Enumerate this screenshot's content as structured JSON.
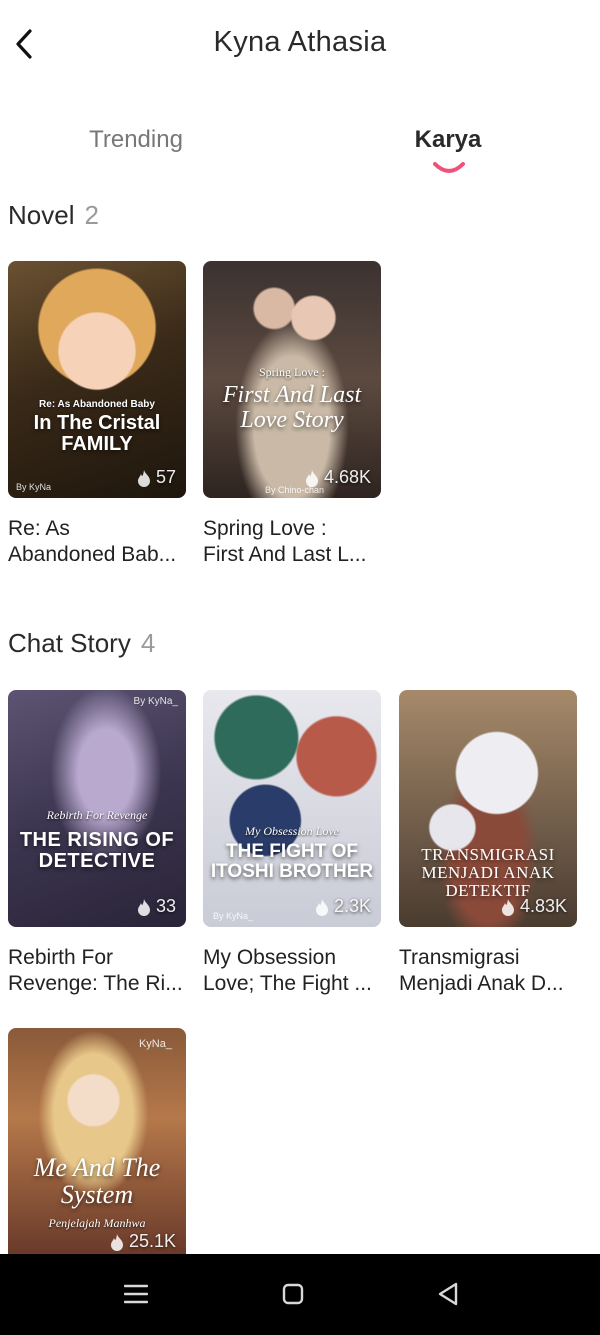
{
  "header": {
    "title": "Kyna Athasia",
    "back_icon": "chevron-left-icon"
  },
  "tabs": [
    {
      "label": "Trending",
      "active": false
    },
    {
      "label": "Karya",
      "active": true
    }
  ],
  "accent_color": "#f0507a",
  "sections": {
    "novel": {
      "title": "Novel",
      "count": "2",
      "items": [
        {
          "cover_sub": "Re: As Abandoned Baby",
          "cover_title": "In The Cristal FAMILY",
          "cover_author": "By KyNa",
          "stat": "57",
          "title_line1": "Re: As",
          "title_line2": "Abandoned Bab..."
        },
        {
          "cover_sub": "Spring Love :",
          "cover_title": "First And Last Love Story",
          "cover_author": "By Chino-chan",
          "stat": "4.68K",
          "title_line1": "Spring Love :",
          "title_line2": "First And Last L..."
        }
      ]
    },
    "chat_story": {
      "title": "Chat Story",
      "count": "4",
      "items": [
        {
          "cover_sub": "Rebirth For Revenge",
          "cover_title": "THE RISING OF DETECTIVE",
          "cover_author": "By KyNa_",
          "stat": "33",
          "title_line1": "Rebirth For",
          "title_line2": "Revenge: The Ri..."
        },
        {
          "cover_sub": "My Obsession Love",
          "cover_title": "THE FIGHT OF ITOSHI BROTHER",
          "cover_author": "By KyNa_",
          "stat": "2.3K",
          "title_line1": "My Obsession",
          "title_line2": "Love; The Fight ..."
        },
        {
          "cover_sub": "",
          "cover_title": "TRANSMIGRASI MENJADI ANAK DETEKTIF",
          "cover_author": "",
          "stat": "4.83K",
          "title_line1": "Transmigrasi",
          "title_line2": "Menjadi Anak D..."
        },
        {
          "cover_sub": "Penjelajah Manhwa",
          "cover_title": "Me And The System",
          "cover_author": "KyNa_",
          "stat": "25.1K",
          "title_line1": "",
          "title_line2": ""
        }
      ]
    }
  },
  "nav": {
    "menu_icon": "menu-icon",
    "home_icon": "home-square-icon",
    "back_icon": "back-triangle-icon"
  }
}
